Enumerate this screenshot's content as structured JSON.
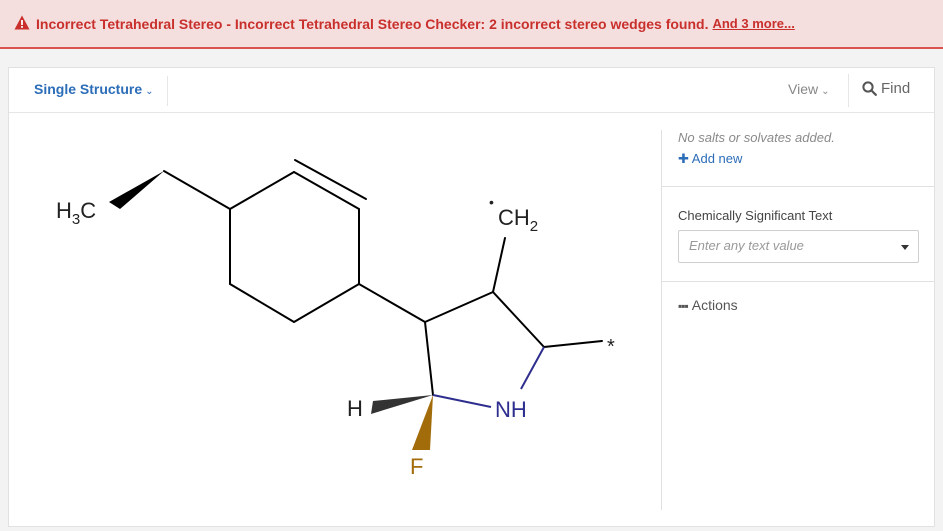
{
  "alert": {
    "icon": "warning-triangle-icon",
    "message": "Incorrect Tetrahedral Stereo - Incorrect Tetrahedral Stereo Checker: 2 incorrect stereo wedges found.",
    "more_link": "And 3 more..."
  },
  "toolbar": {
    "structure_mode": "Single Structure",
    "view_label": "View",
    "find_label": "Find"
  },
  "molecule": {
    "labels": {
      "h3c_h": "H",
      "h3c_sub": "3",
      "h3c_c": "C",
      "ch2_c": "CH",
      "ch2_sub": "2",
      "ch2_radical": "•",
      "nh": "NH",
      "h": "H",
      "f": "F",
      "star": "*"
    },
    "colors": {
      "bond": "#000000",
      "n_bond": "#2e2e8f",
      "f_bond": "#a36c0a",
      "text": "#222222",
      "nh_text": "#2e2e8f",
      "f_text": "#a36c0a"
    }
  },
  "side": {
    "salts_note": "No salts or solvates added.",
    "add_new": "Add new",
    "significant_text_label": "Chemically Significant Text",
    "significant_text_placeholder": "Enter any text value",
    "actions_label": "Actions"
  }
}
